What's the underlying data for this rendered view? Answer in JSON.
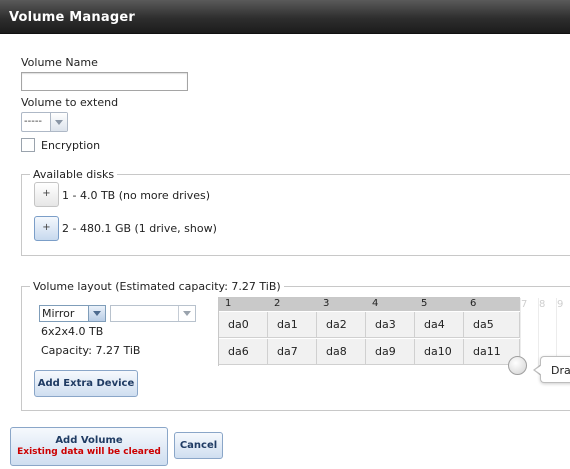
{
  "window": {
    "title": "Volume Manager"
  },
  "form": {
    "volume_name_label": "Volume Name",
    "volume_name_value": "",
    "volume_to_extend_label": "Volume to extend",
    "volume_to_extend_value": "-----",
    "encryption_label": "Encryption",
    "encryption_checked": false
  },
  "available_disks": {
    "legend": "Available disks",
    "items": [
      {
        "label": "1 - 4.0 TB (no more drives)",
        "button": "+"
      },
      {
        "label": "2 - 480.1 GB (1 drive, show)",
        "button": "+"
      }
    ]
  },
  "layout": {
    "legend": "Volume layout (Estimated capacity: 7.27 TiB)",
    "type_value": "Mirror",
    "secondary_value": "",
    "summary": "6x2x4.0 TB",
    "capacity": "Capacity: 7.27 TiB",
    "add_extra_device": "Add Extra Device",
    "columns": [
      "1",
      "2",
      "3",
      "4",
      "5",
      "6"
    ],
    "ghost_columns": [
      "7",
      "8",
      "9"
    ],
    "rows": [
      [
        "da0",
        "da1",
        "da2",
        "da3",
        "da4",
        "da5"
      ],
      [
        "da6",
        "da7",
        "da8",
        "da9",
        "da10",
        "da11"
      ]
    ],
    "tooltip": "Dra"
  },
  "actions": {
    "add_volume": "Add Volume",
    "add_volume_warning": "Existing data will be cleared",
    "cancel": "Cancel"
  },
  "colors": {
    "titlebar": "#2e2e2e",
    "warning": "#cc0000",
    "button_text": "#1f3b63"
  }
}
